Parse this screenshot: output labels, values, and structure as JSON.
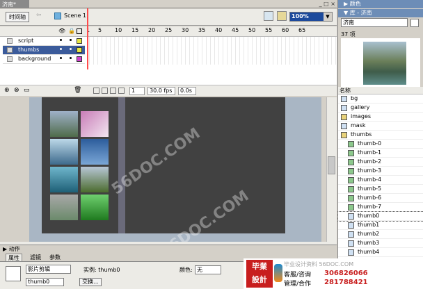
{
  "document": {
    "tab_title": "济南*",
    "window_controls": "_ □ ×"
  },
  "toolbar": {
    "timeline_label": "时间轴",
    "scene_label": "Scene 1",
    "zoom": "100%"
  },
  "timeline": {
    "frame_numbers": [
      "1",
      "5",
      "10",
      "15",
      "20",
      "25",
      "30",
      "35",
      "40",
      "45",
      "50",
      "55",
      "60",
      "65"
    ],
    "layers": [
      {
        "name": "script",
        "selected": false,
        "color": "#e6e642"
      },
      {
        "name": "thumbs",
        "selected": true,
        "color": "#e6e642"
      },
      {
        "name": "background",
        "selected": false,
        "color": "#d040d0"
      }
    ],
    "current_frame": "1",
    "fps": "30.0 fps",
    "time": "0.0s"
  },
  "bottom": {
    "actions_label": "▶ 动作",
    "tabs": [
      "属性",
      "滤镜",
      "参数"
    ],
    "symbol_type": "影片剪辑",
    "instance_label": "实例:",
    "instance_of": "thumb0",
    "instance_name": "thumb0",
    "swap_label": "交换...",
    "color_label": "颜色:",
    "color_value": "无"
  },
  "library": {
    "colors_panel_title": "▶ 颜色",
    "panel_title": "▼ 库 - 济南",
    "selected_library": "济南",
    "item_count": "37 项",
    "column_name": "名称",
    "items": [
      {
        "name": "bg",
        "kind": "symbol"
      },
      {
        "name": "gallery",
        "kind": "symbol"
      },
      {
        "name": "images",
        "kind": "folder"
      },
      {
        "name": "mask",
        "kind": "symbol"
      },
      {
        "name": "thumbs",
        "kind": "folder"
      },
      {
        "name": "thumb-0",
        "kind": "bitmap"
      },
      {
        "name": "thumb-1",
        "kind": "bitmap"
      },
      {
        "name": "thumb-2",
        "kind": "bitmap"
      },
      {
        "name": "thumb-3",
        "kind": "bitmap"
      },
      {
        "name": "thumb-4",
        "kind": "bitmap"
      },
      {
        "name": "thumb-5",
        "kind": "bitmap"
      },
      {
        "name": "thumb-6",
        "kind": "bitmap"
      },
      {
        "name": "thumb-7",
        "kind": "bitmap"
      },
      {
        "name": "thumb0",
        "kind": "symbol"
      },
      {
        "name": "thumb1",
        "kind": "symbol"
      },
      {
        "name": "thumb2",
        "kind": "symbol"
      },
      {
        "name": "thumb3",
        "kind": "symbol"
      },
      {
        "name": "thumb4",
        "kind": "symbol"
      }
    ]
  },
  "watermark": {
    "logo_line1": "毕業",
    "logo_line2": "設計",
    "tagline": "毕业设计资料 56DOC.COM",
    "line1": "客服/咨询",
    "line2": "管理/合作",
    "phone1": "306826066",
    "phone2": "281788421",
    "stage_watermark": "56DOC.COM"
  }
}
